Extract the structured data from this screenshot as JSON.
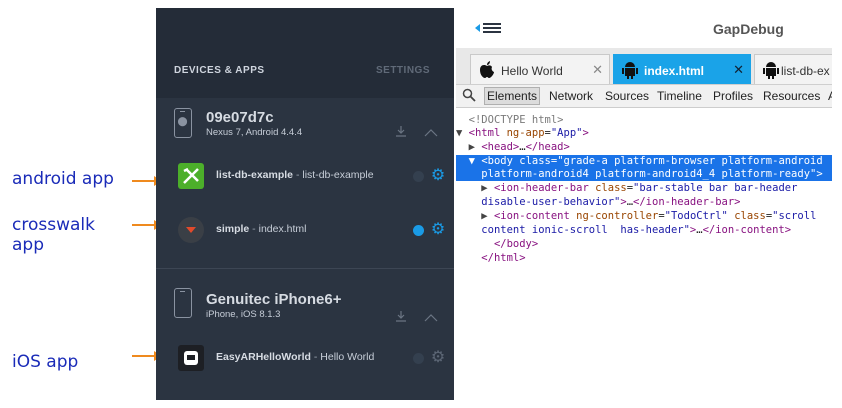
{
  "annotations": {
    "android": "android app",
    "crosswalk_line1": "crosswalk",
    "crosswalk_line2": "app",
    "ios": "iOS app",
    "arrow_color": "#ef8a1e",
    "text_color": "#1a2bb8"
  },
  "sidebar": {
    "header_left": "DEVICES & APPS",
    "header_right": "SETTINGS",
    "devices": [
      {
        "icon": "android-phone-icon",
        "name": "09e07d7c",
        "subtitle": "Nexus 7, Android 4.4.4",
        "apps": [
          {
            "icon": "list-db-app-icon",
            "name": "list-db-example",
            "separator": " - ",
            "page": "list-db-example",
            "status": "inactive",
            "status_color": "#34404f",
            "gear_color": "#1a9be6"
          },
          {
            "icon": "crosswalk-app-icon",
            "name": "simple",
            "separator": " - ",
            "page": "index.html",
            "status": "active",
            "status_color": "#1a9be6",
            "gear_color": "#1a9be6"
          }
        ]
      },
      {
        "icon": "apple-phone-icon",
        "name": "Genuitec iPhone6+",
        "subtitle": "iPhone, iOS 8.1.3",
        "apps": [
          {
            "icon": "easyar-app-icon",
            "name": "EasyARHelloWorld",
            "separator": " - ",
            "page": "Hello World",
            "status": "inactive",
            "status_color": "#34404f",
            "gear_color": "#5c6675"
          }
        ]
      }
    ]
  },
  "debugger": {
    "title": "GapDebug",
    "tabs": [
      {
        "icon": "apple-icon",
        "label": "Hello World",
        "active": false,
        "close": "✕"
      },
      {
        "icon": "android-icon",
        "label": "index.html",
        "active": true,
        "close": "✕"
      },
      {
        "icon": "android-icon",
        "label": "list-db-ex",
        "active": false,
        "close": ""
      }
    ],
    "toolbar": [
      "Elements",
      "Network",
      "Sources",
      "Timeline",
      "Profiles",
      "Resources",
      "A"
    ],
    "code": {
      "doctype": "<!DOCTYPE html>",
      "html_open": [
        "<html",
        " ng-app",
        "=",
        "\"App\"",
        ">"
      ],
      "head": [
        "<head>",
        "…",
        "</head>"
      ],
      "body_line1": [
        "<body",
        " class",
        "=",
        "\"grade-a platform-browser platform-android"
      ],
      "body_line2": "platform-android4 platform-android4_4 platform-ready\">",
      "ionheader_line1": [
        "<ion-header-bar",
        " class",
        "=",
        "\"bar-stable bar bar-header"
      ],
      "ionheader_line2": [
        "disable-user-behavior\"",
        ">",
        "…",
        "</ion-header-bar>"
      ],
      "ioncontent_line1": [
        "<ion-content",
        " ng-controller",
        "=",
        "\"TodoCtrl\"",
        " class",
        "=",
        "\"scroll"
      ],
      "ioncontent_line2": [
        "content ionic-scroll  has-header\"",
        ">",
        "…",
        "</ion-content>"
      ],
      "body_close": "</body>",
      "html_close": "</html>"
    }
  }
}
